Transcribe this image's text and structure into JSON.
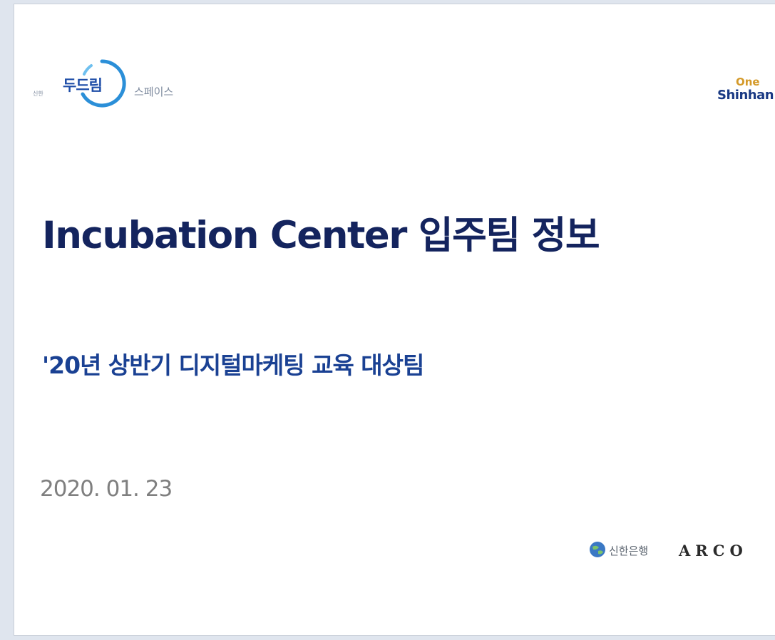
{
  "header": {
    "left_logo": {
      "small_text": "신한",
      "brand_mark": "두드림",
      "brand_suffix": "스페이스"
    },
    "right_logo": {
      "top_text": "One",
      "name_text": "Shinhan"
    }
  },
  "slide": {
    "title": "Incubation Center 입주팀 정보",
    "subtitle": "'20년 상반기 디지털마케팅 교육 대상팀",
    "date": "2020. 01. 23"
  },
  "footer": {
    "bank_name": "신한은행",
    "partner_name": "ARCO"
  },
  "colors": {
    "title": "#14245e",
    "subtitle": "#1a4193",
    "ring": "#2b8fd8",
    "accent_gold": "#d49a2a"
  },
  "icons": {
    "logo_ring": "circle-ring-icon",
    "bank_logo": "globe-icon"
  }
}
